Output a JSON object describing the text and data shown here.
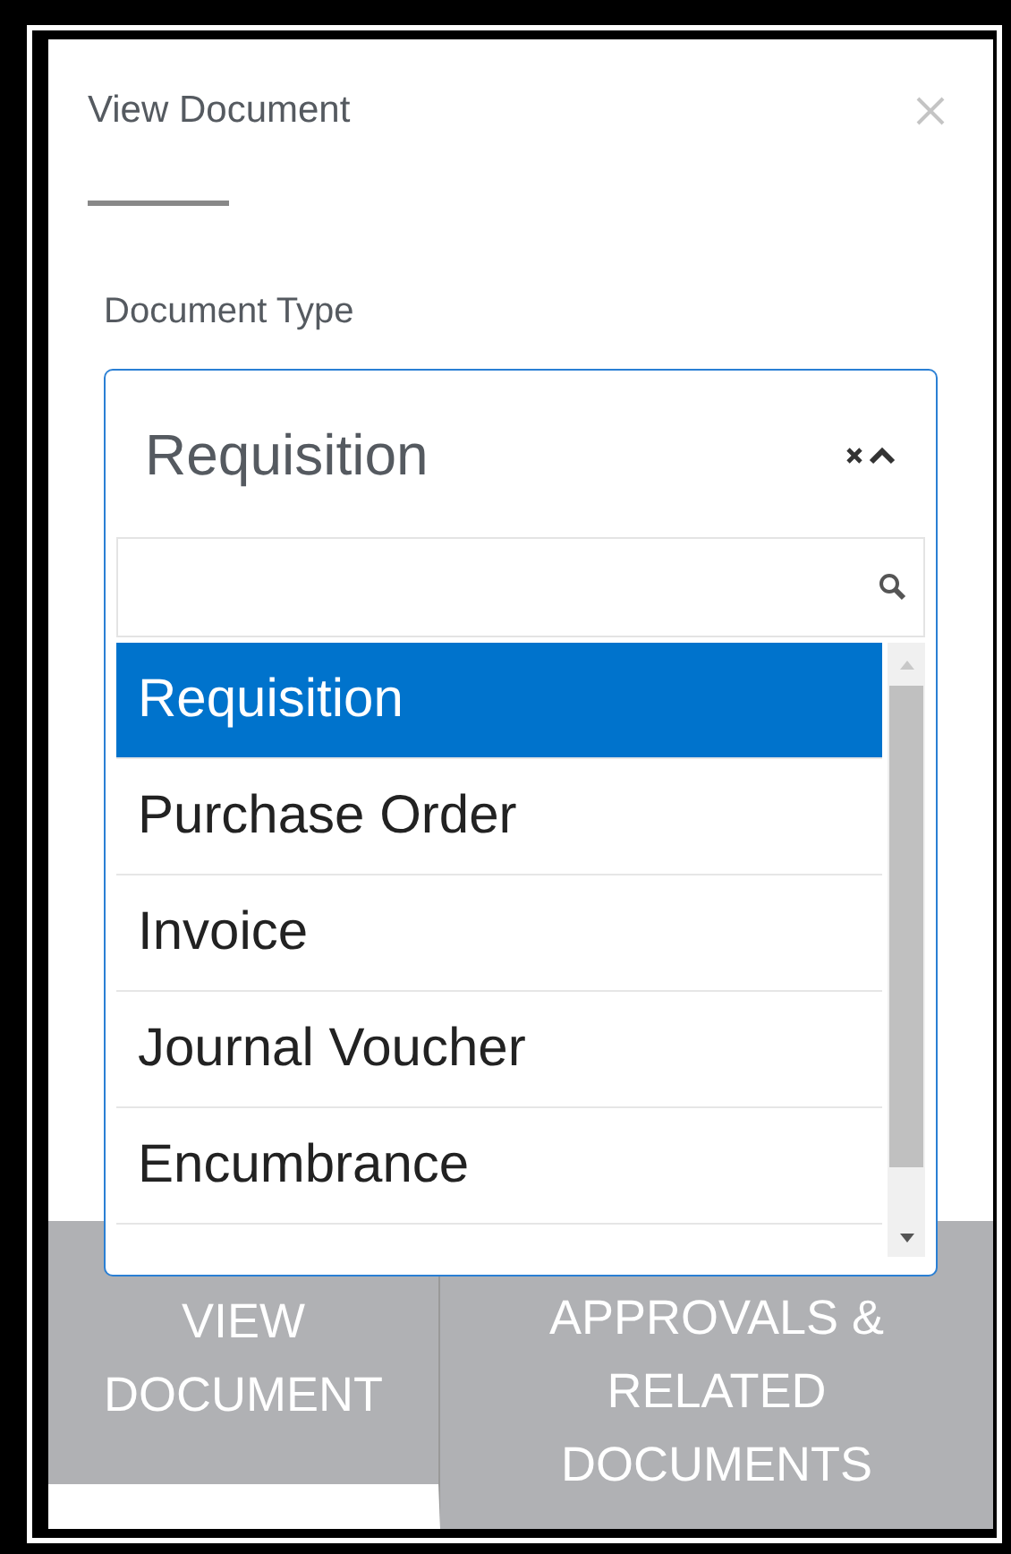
{
  "dialog": {
    "title": "View Document"
  },
  "field": {
    "label": "Document Type",
    "value": "Requisition",
    "expanded": true
  },
  "options": [
    {
      "label": "Requisition",
      "selected": true
    },
    {
      "label": "Purchase Order",
      "selected": false
    },
    {
      "label": "Invoice",
      "selected": false
    },
    {
      "label": "Journal Voucher",
      "selected": false
    },
    {
      "label": "Encumbrance",
      "selected": false
    }
  ],
  "tabs": [
    {
      "label": "VIEW DOCUMENT",
      "selected": true
    },
    {
      "label": "APPROVALS & RELATED DOCUMENTS",
      "selected": false
    }
  ]
}
